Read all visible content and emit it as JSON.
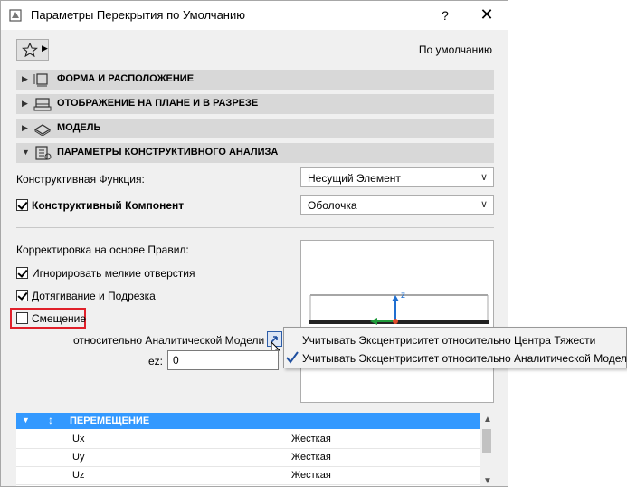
{
  "window": {
    "title": "Параметры Перекрытия по Умолчанию",
    "help_label": "?",
    "close_label": "✕"
  },
  "header": {
    "default_label": "По умолчанию"
  },
  "sections": [
    {
      "label": "ФОРМА И РАСПОЛОЖЕНИЕ",
      "expanded": false
    },
    {
      "label": "ОТОБРАЖЕНИЕ НА ПЛАНЕ И В РАЗРЕЗЕ",
      "expanded": false
    },
    {
      "label": "МОДЕЛЬ",
      "expanded": false
    },
    {
      "label": "ПАРАМЕТРЫ КОНСТРУКТИВНОГО АНАЛИЗА",
      "expanded": true
    }
  ],
  "analysis": {
    "function_label": "Конструктивная Функция:",
    "function_value": "Несущий Элемент",
    "component_label": "Конструктивный Компонент",
    "component_checked": true,
    "component_value": "Оболочка",
    "rules_label": "Корректировка на основе Правил:",
    "ignore_holes_label": "Игнорировать мелкие отверстия",
    "ignore_holes_checked": true,
    "extend_trim_label": "Дотягивание и Подрезка",
    "extend_trim_checked": true,
    "offset_label": "Смещение",
    "offset_checked": false,
    "relative_label": "относительно Аналитической Модели",
    "ez_label": "ez:",
    "ez_value": "0",
    "preview_axis_label": "z"
  },
  "eccentricity_menu": {
    "items": [
      {
        "label": "Учитывать Эксцентриситет относительно Центра Тяжести",
        "checked": false
      },
      {
        "label": "Учитывать Эксцентриситет относительно Аналитической Модели",
        "checked": true
      }
    ]
  },
  "table": {
    "header": "ПЕРЕМЕЩЕНИЕ",
    "rows": [
      {
        "key": "Ux",
        "value": "Жесткая"
      },
      {
        "key": "Uy",
        "value": "Жесткая"
      },
      {
        "key": "Uz",
        "value": "Жесткая"
      }
    ]
  },
  "colors": {
    "highlight_red": "#e0202a",
    "table_header_blue": "#3399ff",
    "axis_blue": "#1f6fd1",
    "axis_green": "#1f9a3a",
    "axis_red": "#e04a2a"
  }
}
